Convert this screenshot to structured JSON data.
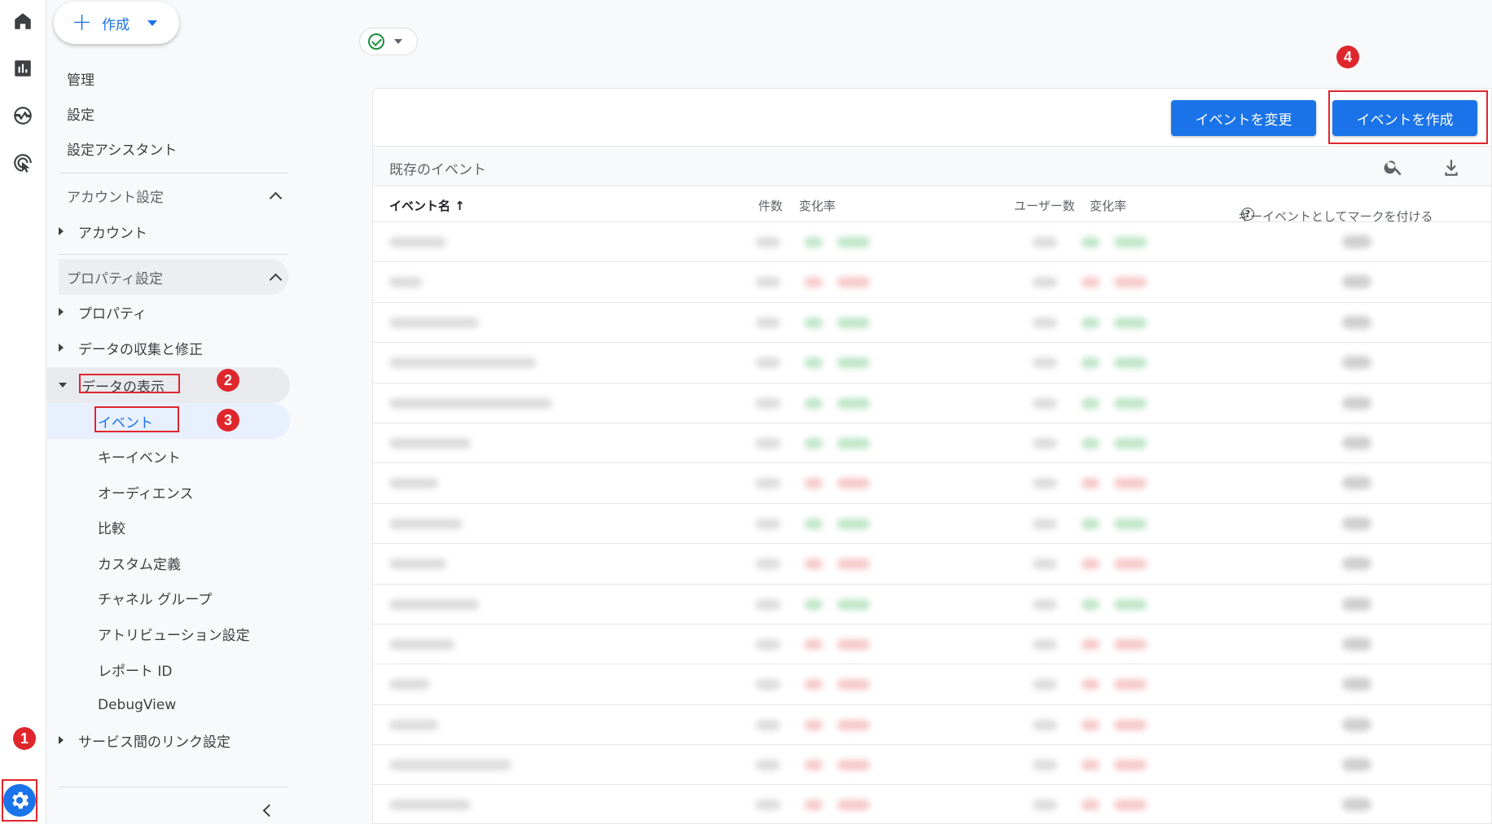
{
  "rail": {
    "icons": [
      "home-icon",
      "reports-icon",
      "explore-icon",
      "advertising-icon",
      "admin-gear-icon"
    ]
  },
  "create_button": {
    "label": "作成"
  },
  "nav": {
    "top_items": [
      "管理",
      "設定",
      "設定アシスタント"
    ],
    "account_section": {
      "title": "アカウント設定",
      "items": [
        "アカウント"
      ]
    },
    "property_section": {
      "title": "プロパティ設定",
      "items": [
        "プロパティ",
        "データの収集と修正",
        "データの表示"
      ],
      "data_display_children": [
        "イベント",
        "キーイベント",
        "オーディエンス",
        "比較",
        "カスタム定義",
        "チャネル グループ",
        "アトリビューション設定",
        "レポート ID",
        "DebugView"
      ],
      "links": "サービス間のリンク設定"
    }
  },
  "annotations": [
    "1",
    "2",
    "3",
    "4"
  ],
  "card": {
    "modify_button": "イベントを変更",
    "create_button": "イベントを作成",
    "subtitle": "既存のイベント",
    "columns": {
      "name": "イベント名 ↑",
      "count": "件数",
      "count_change": "変化率",
      "users": "ユーザー数",
      "users_change": "変化率",
      "key_event": "キーイベントとしてマークを付ける",
      "help": "?"
    }
  },
  "colors": {
    "accent": "#1a73e8",
    "highlight": "#e0262d",
    "selected_bg": "#e8f0fe"
  }
}
